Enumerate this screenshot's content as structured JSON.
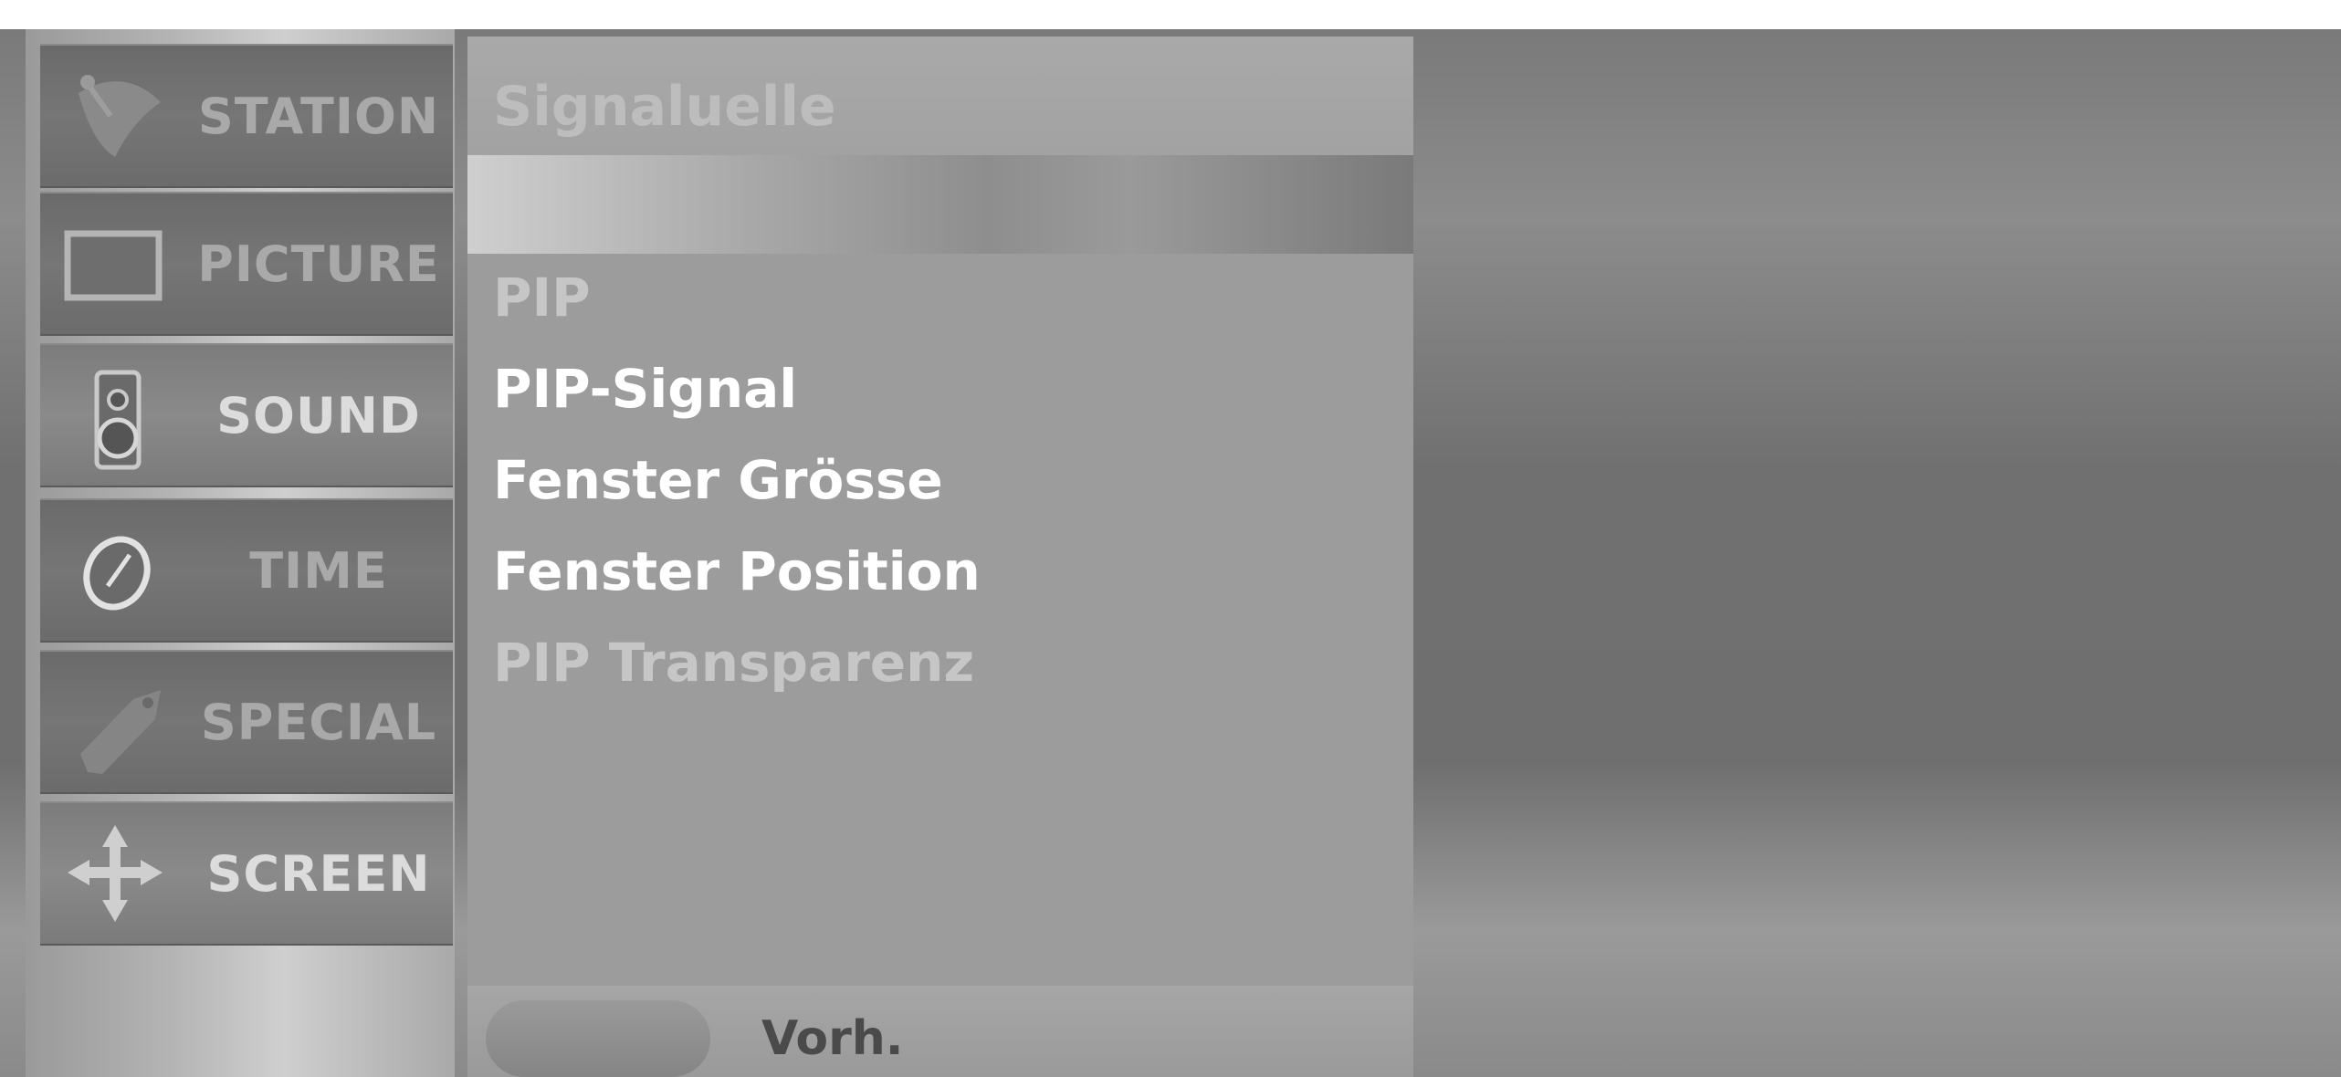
{
  "main_menu": {
    "items": [
      {
        "label": "STATION",
        "icon": "satellite-dish-icon",
        "active": false
      },
      {
        "label": "PICTURE",
        "icon": "tv-screen-icon",
        "active": false
      },
      {
        "label": "SOUND",
        "icon": "speaker-icon",
        "active": true
      },
      {
        "label": "TIME",
        "icon": "clock-icon",
        "active": false
      },
      {
        "label": "SPECIAL",
        "icon": "tag-icon",
        "active": false
      },
      {
        "label": "SCREEN",
        "icon": "move-arrows-icon",
        "active": true
      }
    ]
  },
  "submenu": {
    "title": "Signaluelle",
    "items": [
      {
        "label": "PIP",
        "dim": true
      },
      {
        "label": "PIP-Signal",
        "dim": false
      },
      {
        "label": "Fenster Grösse",
        "dim": false
      },
      {
        "label": "Fenster Position",
        "dim": false
      },
      {
        "label": "PIP Transparenz",
        "dim": true
      }
    ]
  },
  "footer": {
    "label": "Vorh."
  },
  "colors": {
    "menu_background": "#6f6f6f",
    "submenu_background": "#9c9c9c",
    "text_active": "#ffffff",
    "text_dim": "#c6c6c6"
  }
}
